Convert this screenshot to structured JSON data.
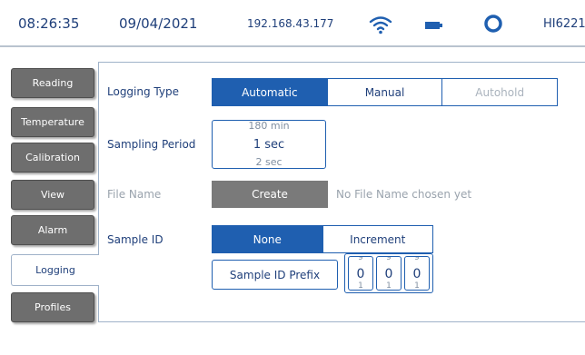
{
  "status_bar": {
    "time": "08:26:35",
    "date": "09/04/2021",
    "ip": "192.168.43.177",
    "model": "HI6221"
  },
  "tabs": [
    {
      "label": "Reading",
      "active": false
    },
    {
      "label": "Temperature",
      "active": false
    },
    {
      "label": "Calibration",
      "active": false
    },
    {
      "label": "View",
      "active": false
    },
    {
      "label": "Alarm",
      "active": false
    },
    {
      "label": "Logging",
      "active": true
    },
    {
      "label": "Profiles",
      "active": false
    }
  ],
  "logging": {
    "logging_type": {
      "label": "Logging Type",
      "options": [
        "Automatic",
        "Manual",
        "Autohold"
      ],
      "selected": "Automatic"
    },
    "sampling_period": {
      "label": "Sampling Period",
      "prev": "180 min",
      "current": "1 sec",
      "next": "2 sec"
    },
    "file_name": {
      "label": "File Name",
      "button": "Create",
      "hint": "No File Name chosen yet"
    },
    "sample_id": {
      "label": "Sample ID",
      "options": [
        "None",
        "Increment"
      ],
      "selected": "None",
      "prefix_button": "Sample ID Prefix",
      "digits": [
        {
          "up": "9",
          "value": "0",
          "down": "1"
        },
        {
          "up": "9",
          "value": "0",
          "down": "1"
        },
        {
          "up": "9",
          "value": "0",
          "down": "1"
        }
      ]
    }
  },
  "colors": {
    "accent": "#1f5fb0",
    "text": "#1f3f7a",
    "tab_inactive": "#6e6e6e"
  }
}
